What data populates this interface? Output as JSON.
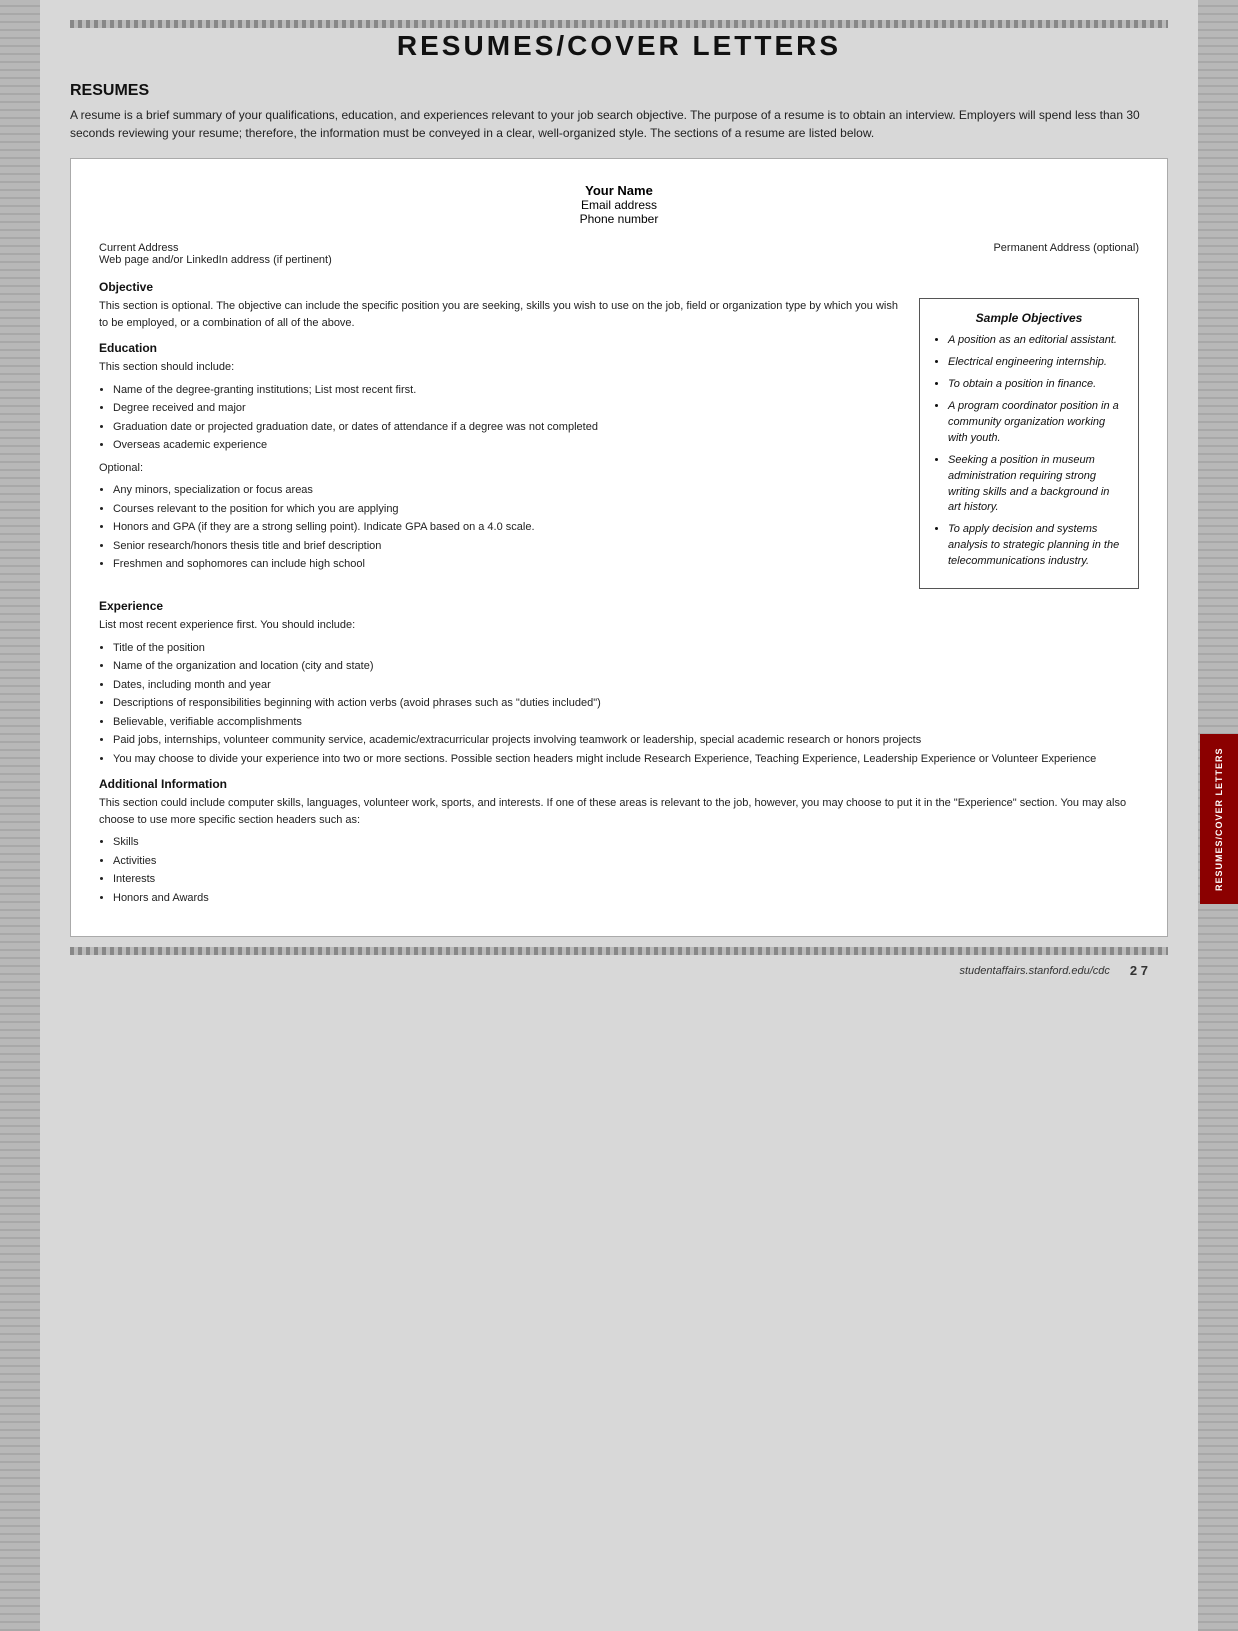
{
  "page": {
    "title": "RESUMES/COVER LETTERS",
    "footer_url": "studentaffairs.stanford.edu/cdc",
    "footer_page": "2 7"
  },
  "resumes_section": {
    "heading": "RESUMES",
    "intro": "A resume is a brief summary of your qualifications, education, and experiences relevant to your job search objective. The purpose of a resume is to obtain an interview. Employers will spend less than 30 seconds reviewing your resume; therefore, the information must be conveyed in a clear, well-organized style. The sections of a resume are listed below."
  },
  "resume_template": {
    "name": "Your Name",
    "email": "Email address",
    "phone": "Phone number",
    "current_address": "Current Address",
    "web_address": "Web page and/or LinkedIn address (if pertinent)",
    "permanent_address": "Permanent Address (optional)",
    "objective_heading": "Objective",
    "objective_text": "This section is optional. The objective can include the specific position you are seeking, skills you wish to use on the job, field or organization type by which you wish to be employed, or a combination of all of the above.",
    "education_heading": "Education",
    "education_intro": "This section should include:",
    "education_bullets": [
      "Name of the degree-granting institutions; List most recent first.",
      "Degree received and major",
      "Graduation date or projected graduation date, or dates of attendance if a degree was not completed",
      "Overseas academic experience"
    ],
    "education_optional_label": "Optional:",
    "education_optional_bullets": [
      "Any minors, specialization or focus areas",
      "Courses relevant to the position for which you are applying",
      "Honors and GPA (if they are a strong selling point). Indicate GPA based on a 4.0 scale.",
      "Senior research/honors thesis title and brief description",
      "Freshmen and sophomores can include high school"
    ],
    "experience_heading": "Experience",
    "experience_intro": "List most recent experience first. You should include:",
    "experience_bullets": [
      "Title of the position",
      "Name of the organization and location (city and state)",
      "Dates, including month and year",
      "Descriptions of responsibilities beginning with action verbs (avoid phrases such as \"duties included\")",
      "Believable, verifiable accomplishments",
      "Paid jobs, internships, volunteer community service, academic/extracurricular projects involving teamwork or leadership, special academic research or honors projects",
      "You may choose to divide your experience into two or more sections. Possible section headers might include Research Experience, Teaching Experience, Leadership Experience or Volunteer Experience"
    ],
    "additional_heading": "Additional Information",
    "additional_text": "This section could include computer skills, languages, volunteer work, sports, and interests. If one of these areas is relevant to the job, however, you may choose to put it in the \"Experience\" section. You may also choose to use more specific section headers such as:",
    "additional_bullets": [
      "Skills",
      "Activities",
      "Interests",
      "Honors and Awards"
    ]
  },
  "sample_objectives": {
    "title": "Sample Objectives",
    "items": [
      "A position as an editorial assistant.",
      "Electrical engineering internship.",
      "To obtain a position in finance.",
      "A program coordinator position in a community organization working with youth.",
      "Seeking a position in museum administration requiring strong writing skills and a background in art history.",
      "To apply decision and systems analysis to strategic planning in the telecommunications industry."
    ]
  },
  "right_tab_label": "RESUMES/COVER LETTERS"
}
